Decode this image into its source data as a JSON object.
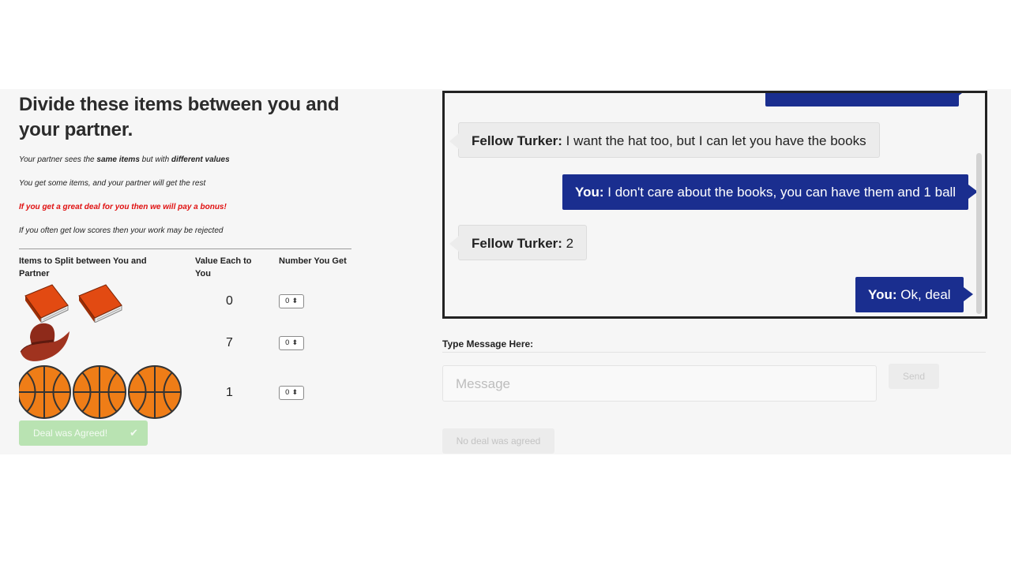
{
  "header": {
    "title": "Divide these items between you and your partner."
  },
  "notes": [
    {
      "pre": "Your partner sees the ",
      "bold1": "same items",
      "mid": " but with ",
      "bold2": "different values"
    },
    {
      "text": "You get some items, and your partner will get the rest"
    },
    {
      "text": "If you get a great deal for you then we will pay a bonus!"
    },
    {
      "text": "If you often get low scores then your work may be rejected"
    }
  ],
  "table": {
    "headers": [
      "Items to Split between You and Partner",
      "Value Each to You",
      "Number You Get"
    ],
    "rows": [
      {
        "item": "book",
        "count": 2,
        "value": "0",
        "selected": "0"
      },
      {
        "item": "hat",
        "count": 1,
        "value": "7",
        "selected": "0"
      },
      {
        "item": "ball",
        "count": 3,
        "value": "1",
        "selected": "0"
      }
    ]
  },
  "deal_button": {
    "label": "Deal was Agreed!",
    "icon": "check-icon"
  },
  "chat": {
    "messages": [
      {
        "sender": "You",
        "text": ""
      },
      {
        "sender": "Fellow Turker",
        "text": "I want the hat too, but I can let you have the books"
      },
      {
        "sender": "You",
        "text": "I don't care about the books, you can have them and 1 ball"
      },
      {
        "sender": "Fellow Turker",
        "text": "2"
      },
      {
        "sender": "You",
        "text": "Ok, deal"
      }
    ]
  },
  "composer": {
    "label": "Type Message Here:",
    "placeholder": "Message",
    "send_label": "Send"
  },
  "no_deal_button": {
    "label": "No deal was agreed"
  },
  "colors": {
    "my_bubble": "#1a2e8f",
    "partner_bubble": "#ececec",
    "bonus_text": "#e01010",
    "deal_button": "#b9e3b2"
  }
}
